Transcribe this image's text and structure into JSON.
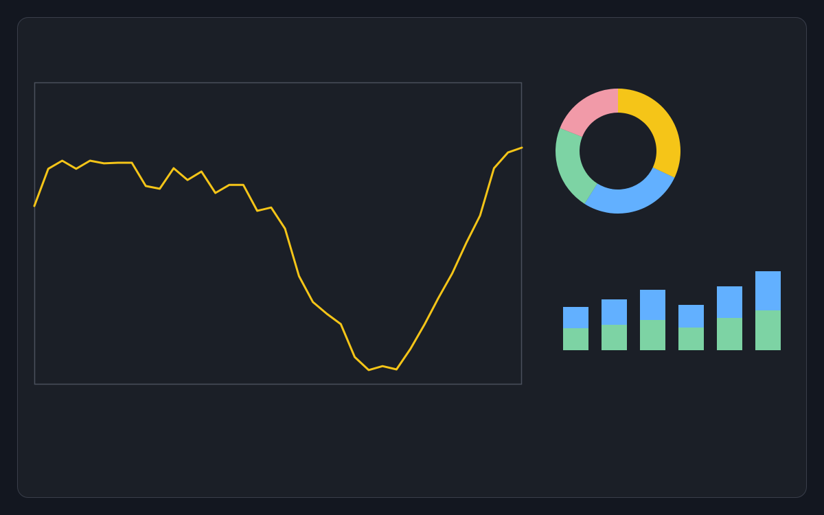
{
  "colors": {
    "background": "#131720",
    "panel": "#1b1f27",
    "panel_border": "#3a3f4b",
    "plot_border": "#4b505c",
    "yellow": "#f5c518",
    "blue": "#62b0ff",
    "green": "#7dd3a4",
    "pink": "#f19aa8"
  },
  "chart_data": [
    {
      "type": "line",
      "title": "",
      "xlabel": "",
      "ylabel": "",
      "grid": false,
      "x": [
        0,
        1,
        2,
        3,
        4,
        5,
        6,
        7,
        8,
        9,
        10,
        11,
        12,
        13,
        14,
        15,
        16,
        17,
        18,
        19,
        20,
        21,
        22,
        23,
        24,
        25,
        26,
        27,
        28,
        29,
        30,
        31,
        32,
        33,
        34,
        35
      ],
      "xlim": [
        0,
        35
      ],
      "ylim": [
        0,
        100
      ],
      "series": [
        {
          "color": "#f5c518",
          "values": [
            59.1,
            71.4,
            74.1,
            71.4,
            74.1,
            73.2,
            73.4,
            73.4,
            65.7,
            64.8,
            71.6,
            67.7,
            70.5,
            63.4,
            66.1,
            66.1,
            57.5,
            58.6,
            51.6,
            35.9,
            27.3,
            23.4,
            20.0,
            9.1,
            4.8,
            6.1,
            5.0,
            11.8,
            19.8,
            28.6,
            36.8,
            46.8,
            55.9,
            71.6,
            76.8,
            78.4
          ]
        }
      ]
    },
    {
      "type": "pie",
      "donut": true,
      "labels": [],
      "values": [
        32,
        27,
        22,
        19
      ],
      "colors": [
        "#f5c518",
        "#62b0ff",
        "#7dd3a4",
        "#f19aa8"
      ]
    },
    {
      "type": "bar",
      "stacked": true,
      "categories": [
        "",
        "",
        "",
        "",
        "",
        ""
      ],
      "ylim": [
        0,
        120
      ],
      "series": [
        {
          "color": "#7dd3a4",
          "values": [
            32,
            37,
            44,
            33,
            47,
            58
          ]
        },
        {
          "color": "#62b0ff",
          "values": [
            31,
            37,
            44,
            33,
            46,
            57
          ]
        }
      ]
    }
  ]
}
